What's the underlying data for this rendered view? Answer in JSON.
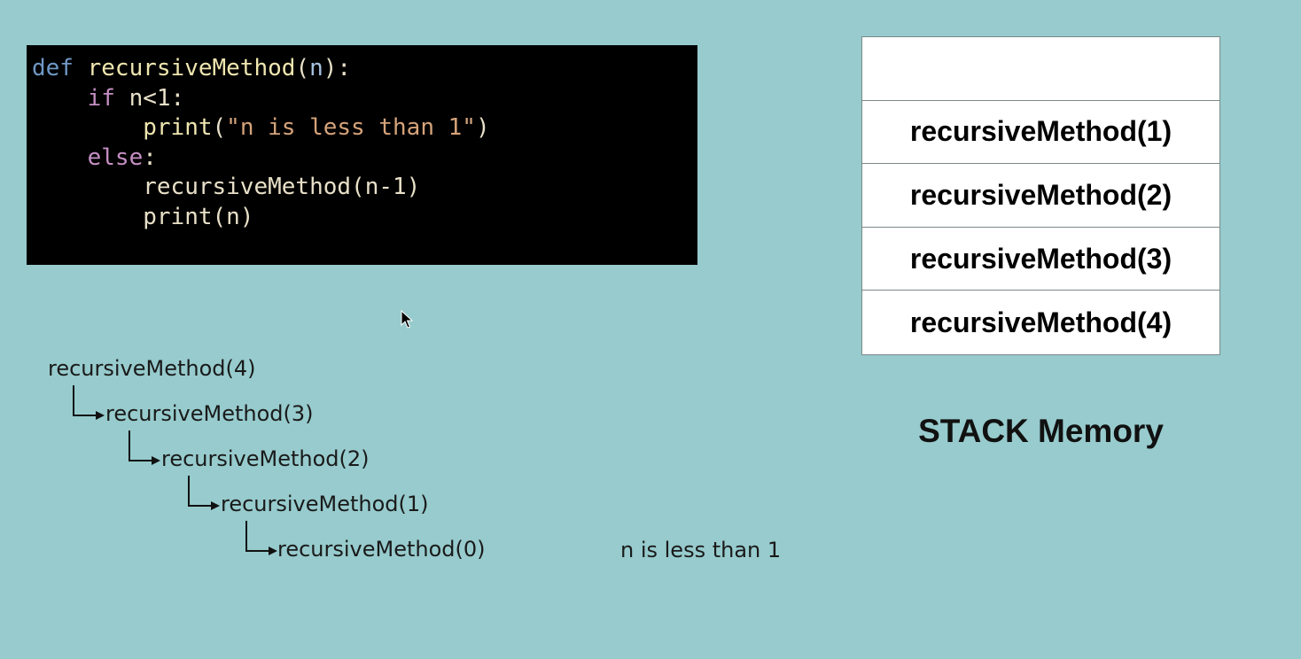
{
  "code": {
    "line1": {
      "kw": "def",
      "fn": "recursiveMethod",
      "open": "(",
      "param": "n",
      "close": "):"
    },
    "line2": {
      "kw": "if",
      "rest": " n<1:"
    },
    "line3": {
      "fn": "print",
      "open": "(",
      "str": "\"n is less than 1\"",
      "close": ")"
    },
    "line4": {
      "kw": "else",
      "rest": ":"
    },
    "line5": {
      "text": "recursiveMethod(n-1)"
    },
    "line6": {
      "text": "print(n)"
    }
  },
  "stack": {
    "frames": [
      "",
      "recursiveMethod(1)",
      "recursiveMethod(2)",
      "recursiveMethod(3)",
      "recursiveMethod(4)"
    ],
    "title": "STACK Memory"
  },
  "call_tree": [
    "recursiveMethod(4)",
    "recursiveMethod(3)",
    "recursiveMethod(2)",
    "recursiveMethod(1)",
    "recursiveMethod(0)"
  ],
  "output": "n is less than 1"
}
